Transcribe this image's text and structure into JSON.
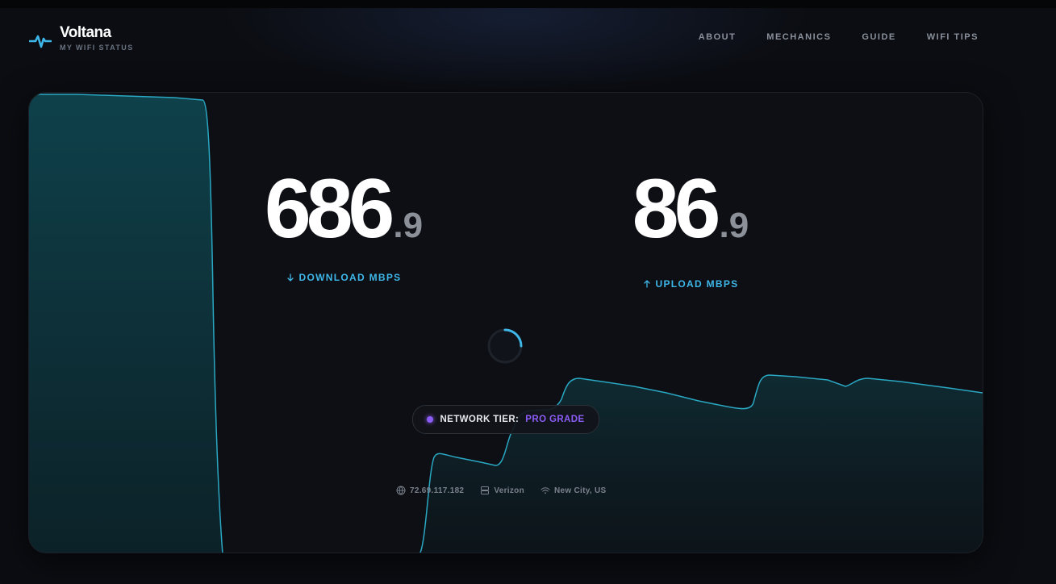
{
  "brand": {
    "name": "Voltana",
    "subtitle": "MY WIFI STATUS"
  },
  "nav": {
    "items": [
      "ABOUT",
      "MECHANICS",
      "GUIDE",
      "WIFI TIPS"
    ]
  },
  "download": {
    "value": "686",
    "decimal": ".9",
    "label": "DOWNLOAD MBPS",
    "icon": "arrow-down-icon"
  },
  "upload": {
    "value": "86",
    "decimal": ".9",
    "label": "UPLOAD MBPS",
    "icon": "arrow-up-icon"
  },
  "tier": {
    "label": "NETWORK TIER:",
    "value": "PRO GRADE"
  },
  "info": {
    "ip": "72.69.117.182",
    "provider": "Verizon",
    "location": "New City, US"
  },
  "colors": {
    "accent": "#3eb6e8",
    "tier": "#8b5cf6",
    "graph_line": "#2aa7c2"
  }
}
